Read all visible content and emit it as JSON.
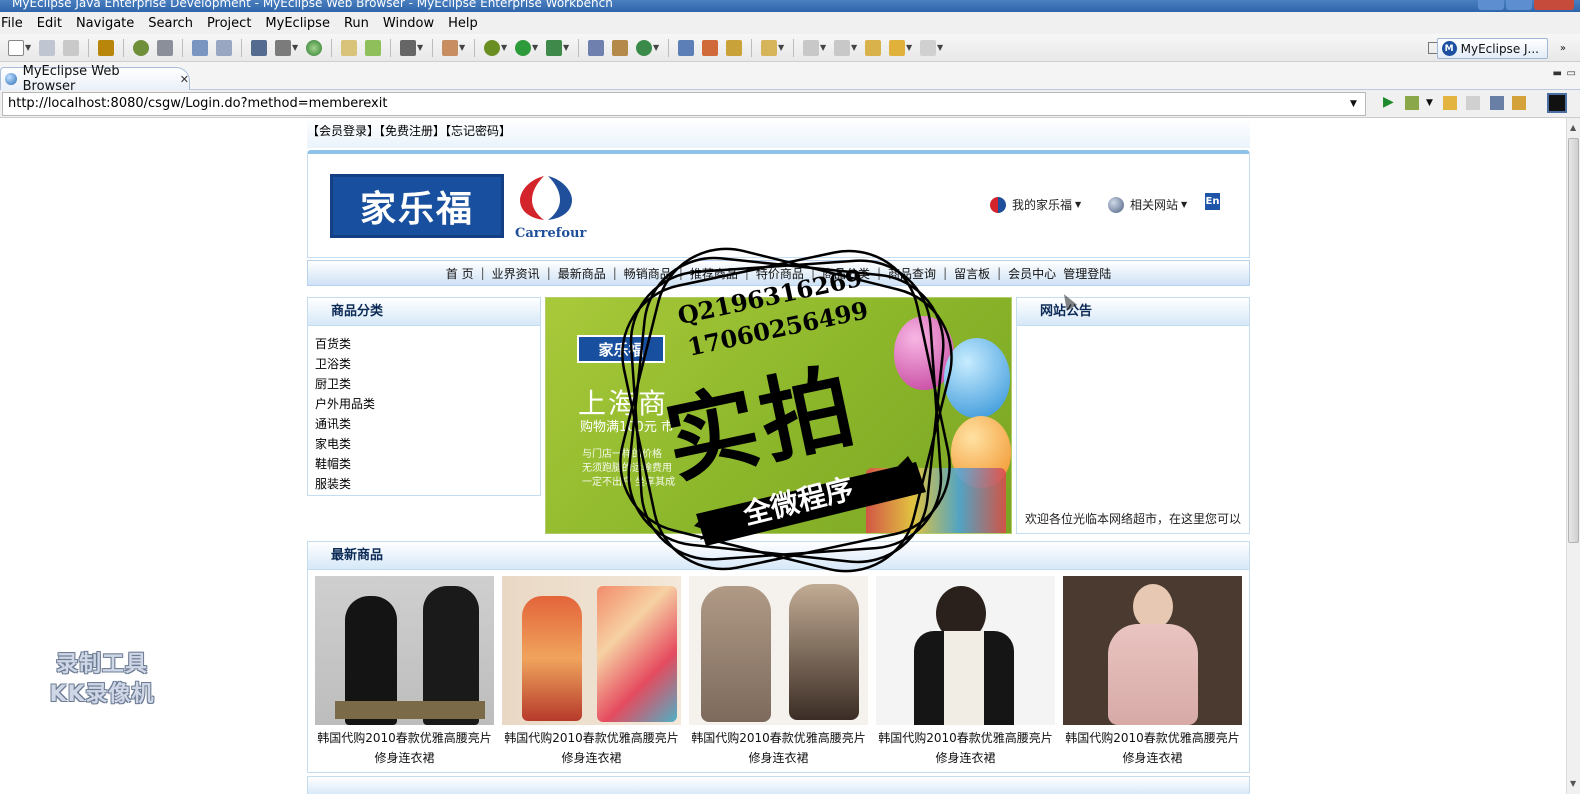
{
  "window": {
    "title": "MyEclipse Java Enterprise Development - MyEclipse Web Browser - MyEclipse Enterprise Workbench"
  },
  "menu": [
    "File",
    "Edit",
    "Navigate",
    "Search",
    "Project",
    "MyEclipse",
    "Run",
    "Window",
    "Help"
  ],
  "perspective": {
    "label": "MyEclipse J..."
  },
  "tab": {
    "label": "MyEclipse Web Browser"
  },
  "browser": {
    "url": "http://localhost:8080/csgw/Login.do?method=memberexit"
  },
  "site": {
    "toplinks": [
      "【会员登录】",
      "【免费注册】",
      "【忘记密码】"
    ],
    "logo": {
      "cn": "家乐福",
      "en": "Carrefour"
    },
    "header_links": [
      "我的家乐福",
      "相关网站"
    ],
    "lang": "En",
    "nav": [
      "首 页",
      "业界资讯",
      "最新商品",
      "畅销商品",
      "推荐商品",
      "特价商品",
      "商品分类",
      "商品查询",
      "留言板",
      "会员中心",
      "管理登陆"
    ],
    "categories": {
      "title": "商品分类",
      "items": [
        "百货类",
        "卫浴类",
        "厨卫类",
        "户外用品类",
        "通讯类",
        "家电类",
        "鞋帽类",
        "服装类"
      ]
    },
    "banner": {
      "logo": "家乐福",
      "headline": "上海商",
      "sub": "购物满100元 市",
      "note": "与门店一样的价格\n无须跑腿的运输费用\n一定不出户 坐享其成"
    },
    "notice": {
      "title": "网站公告",
      "text": "欢迎各位光临本网络超市，在这里您可以"
    },
    "new_products": {
      "title": "最新商品",
      "items": [
        {
          "name": "韩国代购2010春款优雅高腰亮片修身连衣裙"
        },
        {
          "name": "韩国代购2010春款优雅高腰亮片修身连衣裙"
        },
        {
          "name": "韩国代购2010春款优雅高腰亮片修身连衣裙"
        },
        {
          "name": "韩国代购2010春款优雅高腰亮片修身连衣裙"
        },
        {
          "name": "韩国代购2010春款优雅高腰亮片修身连衣裙"
        }
      ]
    }
  },
  "overlay": {
    "stamp": {
      "qq": "Q2196316269",
      "phone": "17060256499",
      "main": "实拍",
      "ribbon": "全微程序"
    },
    "watermark": [
      "录制工具",
      "KK录像机"
    ]
  }
}
